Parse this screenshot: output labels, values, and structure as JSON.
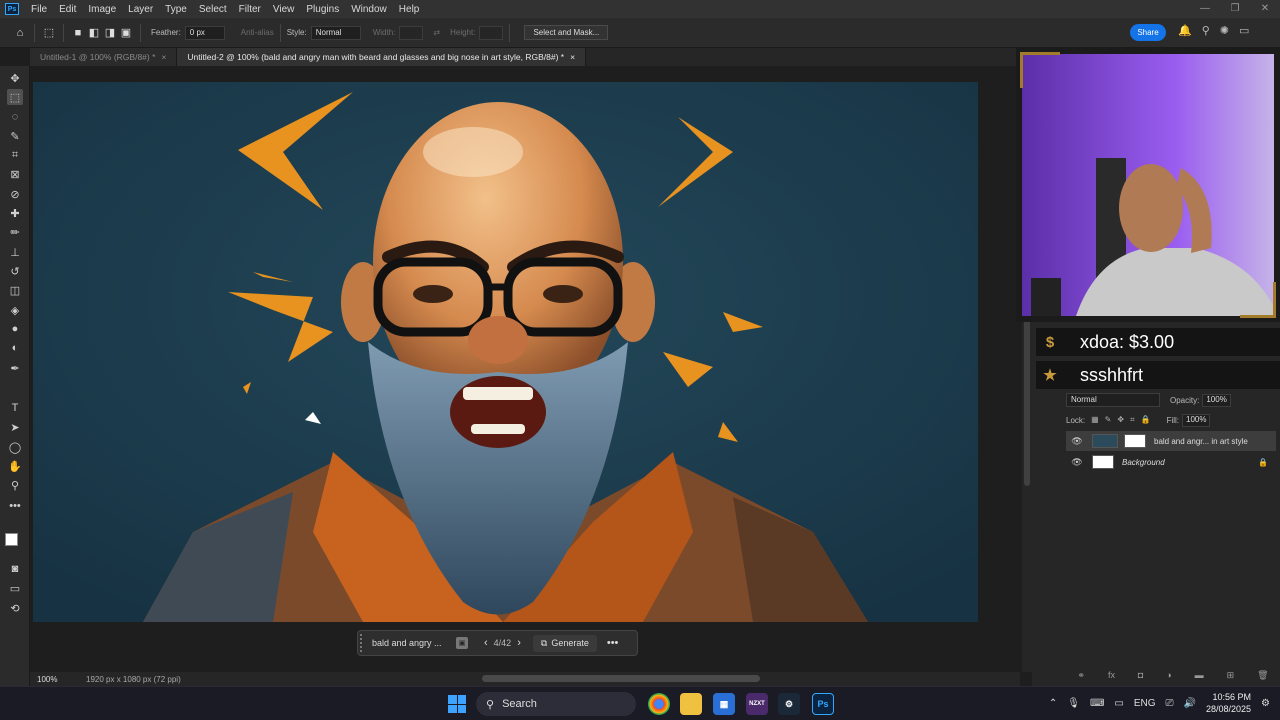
{
  "menubar": {
    "items": [
      "File",
      "Edit",
      "Image",
      "Layer",
      "Type",
      "Select",
      "Filter",
      "View",
      "Plugins",
      "Window",
      "Help"
    ]
  },
  "options": {
    "feather_label": "Feather:",
    "feather_value": "0 px",
    "anti_alias": "Anti-alias",
    "style_label": "Style:",
    "style_value": "Normal",
    "width_label": "Width:",
    "height_label": "Height:",
    "select_mask": "Select and Mask...",
    "share": "Share"
  },
  "tabs": [
    {
      "label": "Untitled-1 @ 100% (RGB/8#) *",
      "close": "×"
    },
    {
      "label": "Untitled-2 @ 100% (bald and angry man with beard and glasses and big nose in art style, RGB/8#) *",
      "close": "×"
    }
  ],
  "contextbar": {
    "prompt": "bald and angry ...",
    "count": "4/42",
    "generate": "Generate",
    "more": "•••"
  },
  "status": {
    "zoom": "100%",
    "dims": "1920 px x 1080 px (72 ppi)"
  },
  "stream": {
    "donation": "xdoa: $3.00",
    "follower": "ssshhfrt"
  },
  "layers": {
    "blend": "Normal",
    "opacity_label": "Opacity:",
    "opacity_value": "100%",
    "lock_label": "Lock:",
    "fill_label": "Fill:",
    "fill_value": "100%",
    "items": [
      {
        "name": "bald and angr... in art style"
      },
      {
        "name": "Background"
      }
    ]
  },
  "taskbar": {
    "search": "Search",
    "lang": "ENG",
    "time": "10:56 PM",
    "date": "28/08/2025"
  },
  "colors": {
    "accent": "#1473e6",
    "canvas_bg": "#1b3a4b",
    "orange": "#e8931f",
    "gold": "#a27b2b"
  }
}
